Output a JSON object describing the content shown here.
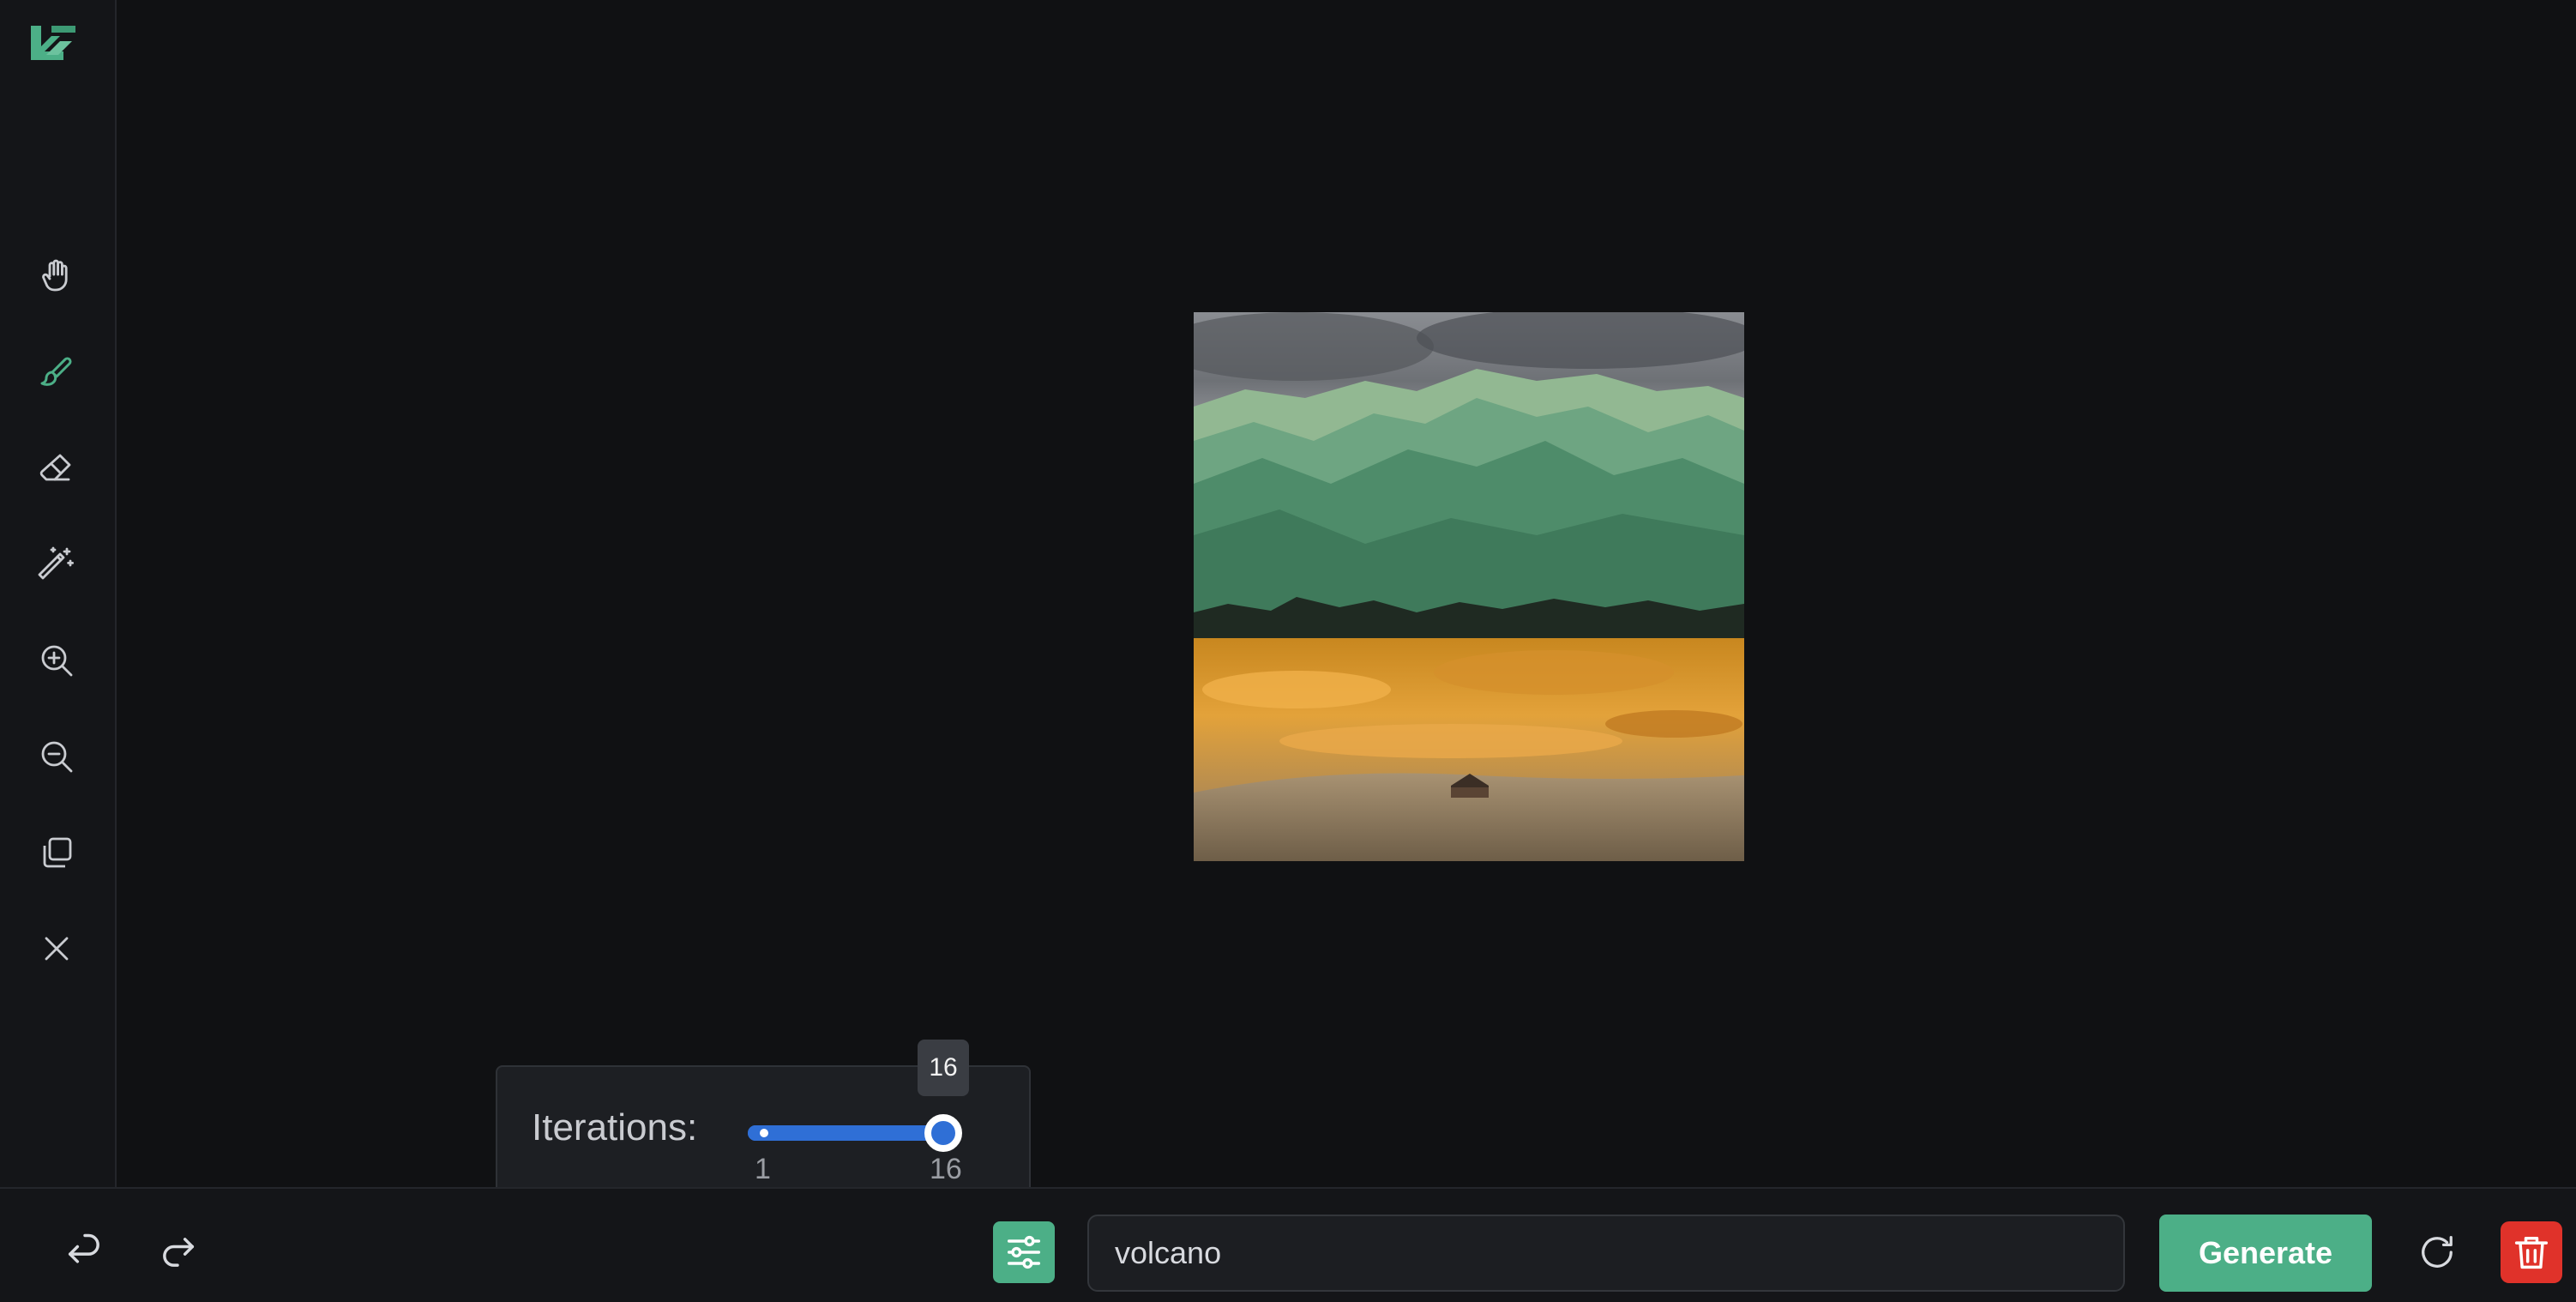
{
  "app": {
    "logo_icon": "brand-logo-icon"
  },
  "toolbar": {
    "tools": [
      {
        "name": "pan",
        "icon": "hand-icon"
      },
      {
        "name": "brush",
        "icon": "brush-icon",
        "active": true
      },
      {
        "name": "eraser",
        "icon": "eraser-icon"
      },
      {
        "name": "magic-wand",
        "icon": "magic-wand-icon"
      },
      {
        "name": "zoom-in",
        "icon": "zoom-in-icon"
      },
      {
        "name": "zoom-out",
        "icon": "zoom-out-icon"
      },
      {
        "name": "copy",
        "icon": "copy-icon"
      },
      {
        "name": "close",
        "icon": "close-icon"
      }
    ]
  },
  "iterations": {
    "label": "Iterations:",
    "min": 1,
    "max": 16,
    "value": 16,
    "min_label": "1",
    "max_label": "16",
    "tooltip": "16"
  },
  "bottom": {
    "undo_icon": "undo-icon",
    "redo_icon": "redo-icon",
    "settings_icon": "sliders-icon",
    "prompt_value": "volcano",
    "generate_label": "Generate",
    "reset_icon": "refresh-icon",
    "delete_icon": "trash-icon"
  },
  "colors": {
    "accent": "#4caf87",
    "slider": "#2f6fd6",
    "danger": "#e0322a",
    "background": "#101113"
  }
}
